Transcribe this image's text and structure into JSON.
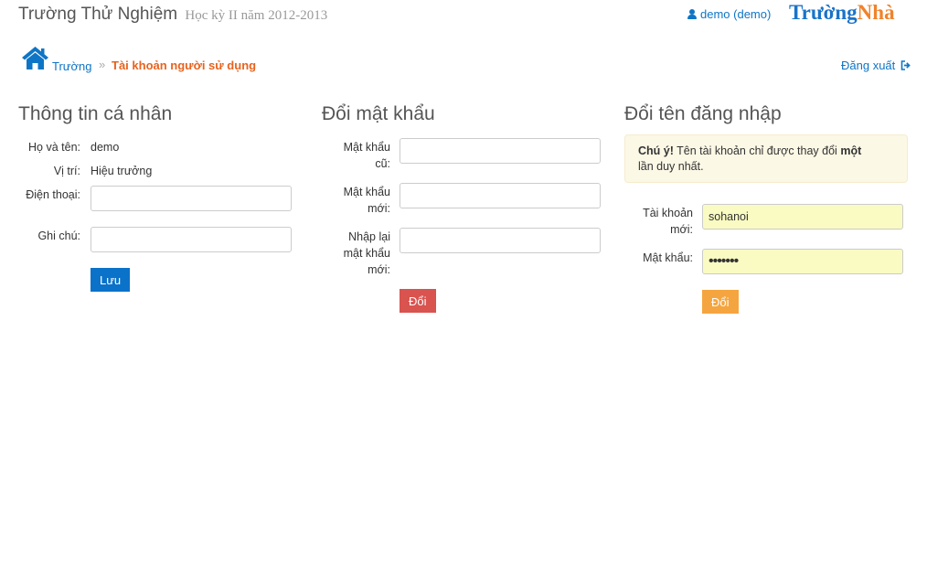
{
  "header": {
    "school_name": "Trường Thử Nghiệm",
    "semester": "Học kỳ II năm 2012-2013",
    "user_label": "demo (demo)",
    "logo_part1": "Trường",
    "logo_part2": "Nhà"
  },
  "breadcrumb": {
    "home_label": "Trường",
    "separator": "»",
    "current": "Tài khoản người sử dụng"
  },
  "logout_label": "Đăng xuất",
  "personal": {
    "title": "Thông tin cá nhân",
    "name_label": "Họ và tên:",
    "name_value": "demo",
    "position_label": "Vị trí:",
    "position_value": "Hiệu trưởng",
    "phone_label": "Điện thoại:",
    "phone_value": "",
    "note_label": "Ghi chú:",
    "note_value": "",
    "save_label": "Lưu"
  },
  "password": {
    "title": "Đổi mật khẩu",
    "old_label_1": "Mật khẩu",
    "old_label_2": "cũ:",
    "new_label_1": "Mật khẩu",
    "new_label_2": "mới:",
    "confirm_label_1": "Nhập lại",
    "confirm_label_2": "mật khẩu",
    "confirm_label_3": "mới:",
    "submit_label": "Đổi"
  },
  "username": {
    "title": "Đổi tên đăng nhập",
    "alert_strong": "Chú ý!",
    "alert_text_1": "Tên tài khoản chỉ được thay đổi",
    "alert_strong_2": "một",
    "alert_text_2": "lần duy nhất.",
    "account_label_1": "Tài khoản",
    "account_label_2": "mới:",
    "account_value": "sohanoi",
    "password_label": "Mật khẩu:",
    "password_value": "1234567",
    "submit_label": "Đổi"
  },
  "colors": {
    "link_blue": "#0e75c6",
    "breadcrumb_orange": "#e8631e",
    "save_blue": "#0b72c9",
    "change_red": "#d9534f",
    "change_orange": "#f5a540",
    "alert_bg": "#fcf8e6",
    "autofill_yellow": "#fafbc2"
  },
  "icons": {
    "user": "user-icon",
    "home": "home-icon",
    "logout": "sign-out-icon"
  }
}
